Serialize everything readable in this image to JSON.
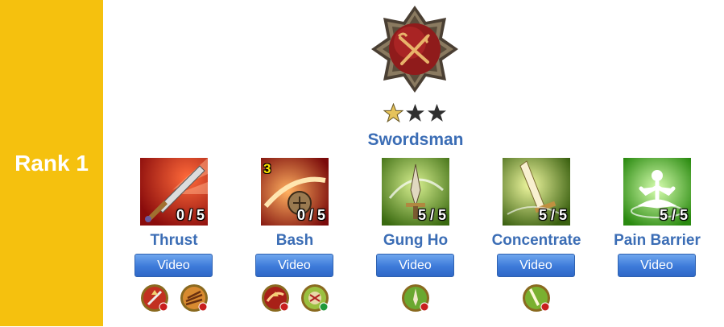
{
  "rank": {
    "label": "Rank 1"
  },
  "class": {
    "name": "Swordsman",
    "stars_filled": 1,
    "stars_total": 3,
    "emblem_icon": "crossed-swords-emblem-icon"
  },
  "skills": [
    {
      "name": "Thrust",
      "level": "0 / 5",
      "video_label": "Video",
      "icon": "sword-thrust-icon",
      "modifiers": [
        "thrust-upgrade-icon",
        "thrust-spread-icon"
      ]
    },
    {
      "name": "Bash",
      "level": "0 / 5",
      "badge": "3",
      "video_label": "Video",
      "icon": "shield-bash-icon",
      "modifiers": [
        "bash-upgrade-icon",
        "bash-stun-icon"
      ]
    },
    {
      "name": "Gung Ho",
      "level": "5 / 5",
      "video_label": "Video",
      "icon": "gung-ho-sword-icon",
      "modifiers": [
        "gung-ho-upgrade-icon"
      ]
    },
    {
      "name": "Concentrate",
      "level": "5 / 5",
      "video_label": "Video",
      "icon": "concentrate-blade-icon",
      "modifiers": [
        "concentrate-upgrade-icon"
      ]
    },
    {
      "name": "Pain Barrier",
      "level": "5 / 5",
      "video_label": "Video",
      "icon": "meditation-icon",
      "modifiers": []
    }
  ],
  "colors": {
    "sidebar": "#f5c10e",
    "link": "#3b6db5",
    "button": "#3d7ad9"
  }
}
